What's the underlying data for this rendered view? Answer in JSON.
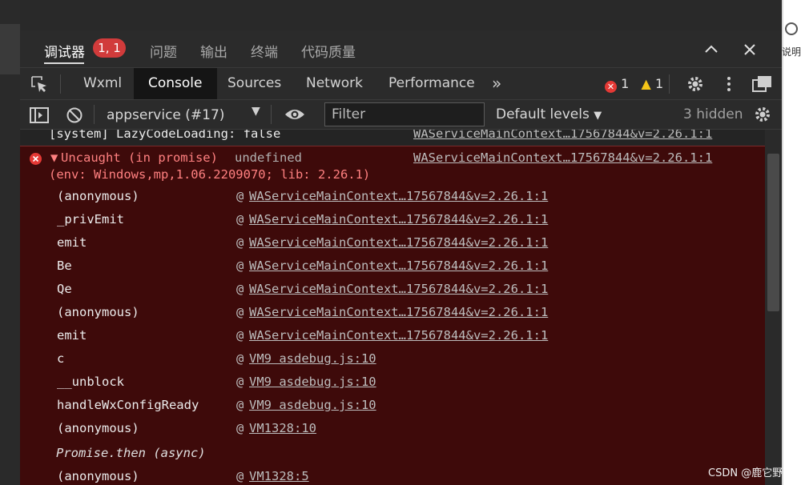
{
  "top_panel_tabs": [
    {
      "label": "调试器",
      "active": true
    },
    {
      "label": "问题"
    },
    {
      "label": "输出"
    },
    {
      "label": "终端"
    },
    {
      "label": "代码质量"
    }
  ],
  "debugger_badge": "1, 1",
  "devtools_tabs": [
    {
      "label": "Wxml"
    },
    {
      "label": "Console",
      "active": true
    },
    {
      "label": "Sources"
    },
    {
      "label": "Network"
    },
    {
      "label": "Performance"
    }
  ],
  "more_tabs_icon": "»",
  "error_count": "1",
  "warning_count": "1",
  "toolbar": {
    "context": "appservice (#17)",
    "filter_placeholder": "Filter",
    "levels": "Default levels",
    "hidden": "3 hidden"
  },
  "console": {
    "system_line": {
      "text": "[system] LazyCodeLoading: false",
      "source": "WAServiceMainContext…17567844&v=2.26.1:1"
    },
    "error": {
      "title": "Uncaught (in promise)",
      "value": "undefined",
      "source": "WAServiceMainContext…17567844&v=2.26.1:1",
      "env": "(env: Windows,mp,1.06.2209070; lib: 2.26.1)"
    },
    "stack": [
      {
        "fn": "(anonymous)",
        "source": "WAServiceMainContext…17567844&v=2.26.1:1"
      },
      {
        "fn": "_privEmit",
        "source": "WAServiceMainContext…17567844&v=2.26.1:1"
      },
      {
        "fn": "emit",
        "source": "WAServiceMainContext…17567844&v=2.26.1:1"
      },
      {
        "fn": "Be",
        "source": "WAServiceMainContext…17567844&v=2.26.1:1"
      },
      {
        "fn": "Qe",
        "source": "WAServiceMainContext…17567844&v=2.26.1:1"
      },
      {
        "fn": "(anonymous)",
        "source": "WAServiceMainContext…17567844&v=2.26.1:1"
      },
      {
        "fn": "emit",
        "source": "WAServiceMainContext…17567844&v=2.26.1:1"
      },
      {
        "fn": "c",
        "source": "VM9 asdebug.js:10"
      },
      {
        "fn": "__unblock",
        "source": "VM9 asdebug.js:10"
      },
      {
        "fn": "handleWxConfigReady",
        "source": "VM9 asdebug.js:10"
      },
      {
        "fn": "(anonymous)",
        "source": "VM1328:10"
      }
    ],
    "async_label": "Promise.then (async)",
    "async_stack": [
      {
        "fn": "(anonymous)",
        "source": "VM1328:5"
      }
    ]
  },
  "right_edge_text": "说明",
  "watermark": "CSDN @鹿它野"
}
